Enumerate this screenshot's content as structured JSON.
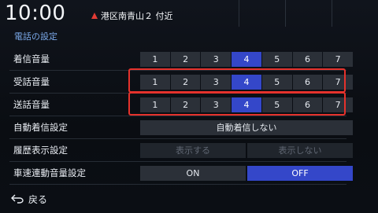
{
  "status": {
    "clock": "10:00",
    "location": "港区南青山２ 付近"
  },
  "page": {
    "title": "電話の設定"
  },
  "rows": {
    "ring_volume": {
      "label": "着信音量",
      "levels": [
        "1",
        "2",
        "3",
        "4",
        "5",
        "6",
        "7"
      ],
      "selected": "4"
    },
    "receive_volume": {
      "label": "受話音量",
      "levels": [
        "1",
        "2",
        "3",
        "4",
        "5",
        "6",
        "7"
      ],
      "selected": "4"
    },
    "send_volume": {
      "label": "送話音量",
      "levels": [
        "1",
        "2",
        "3",
        "4",
        "5",
        "6",
        "7"
      ],
      "selected": "4"
    },
    "auto_answer": {
      "label": "自動着信設定",
      "value": "自動着信しない"
    },
    "history_display": {
      "label": "履歴表示設定",
      "option_show": "表示する",
      "option_hide": "表示しない"
    },
    "speed_volume": {
      "label": "車速連動音量設定",
      "option_on": "ON",
      "option_off": "OFF",
      "selected": "OFF"
    }
  },
  "footer": {
    "back_label": "戻る"
  },
  "colors": {
    "selected": "#3447c9",
    "highlight": "#e5322c",
    "title": "#7aa8e8"
  }
}
